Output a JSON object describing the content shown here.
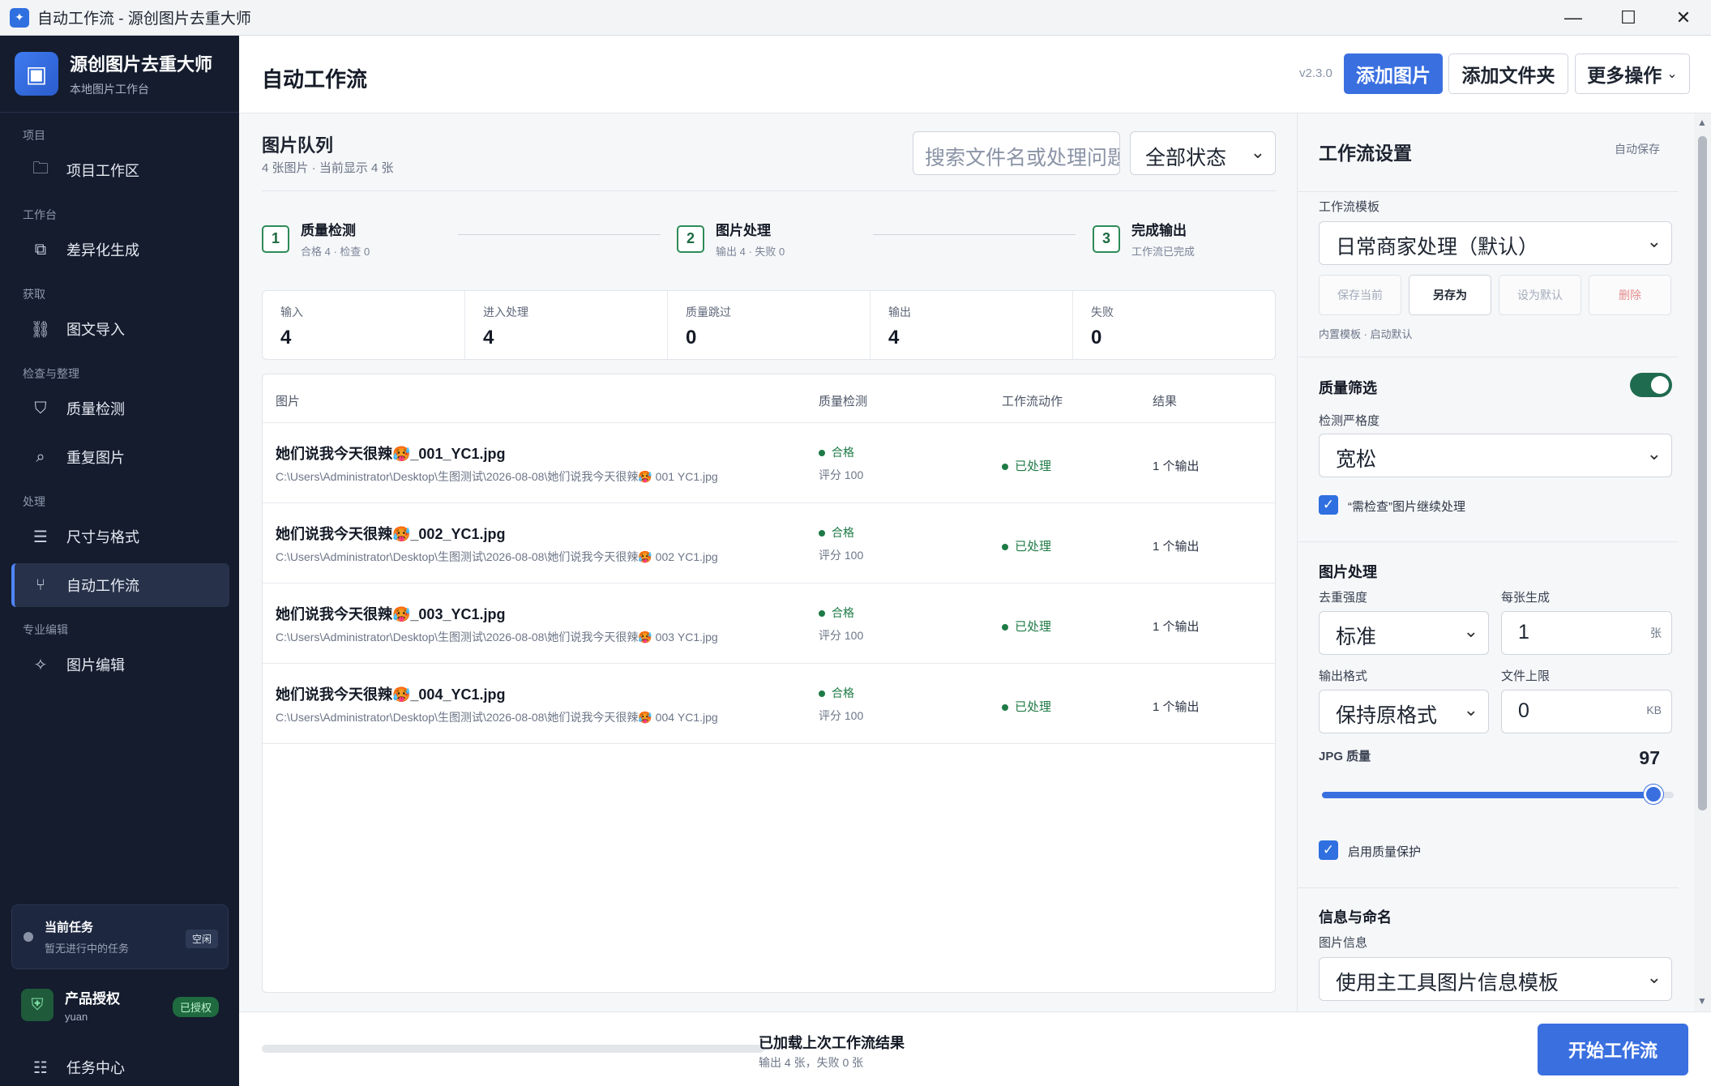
{
  "window": {
    "title": "自动工作流 - 源创图片去重大师"
  },
  "sidebar": {
    "brand_name": "源创图片去重大师",
    "brand_sub": "本地图片工作台",
    "sections": [
      {
        "title": "项目",
        "items": [
          {
            "label": "项目工作区",
            "icon": "folder-icon"
          }
        ]
      },
      {
        "title": "工作台",
        "items": [
          {
            "label": "差异化生成",
            "icon": "image-stack-icon"
          }
        ]
      },
      {
        "title": "获取",
        "items": [
          {
            "label": "图文导入",
            "icon": "link-icon"
          }
        ]
      },
      {
        "title": "检查与整理",
        "items": [
          {
            "label": "质量检测",
            "icon": "shield-check-icon"
          },
          {
            "label": "重复图片",
            "icon": "duplicate-search-icon"
          }
        ]
      },
      {
        "title": "处理",
        "items": [
          {
            "label": "尺寸与格式",
            "icon": "sliders-icon"
          },
          {
            "label": "自动工作流",
            "icon": "workflow-icon",
            "active": true
          }
        ]
      },
      {
        "title": "专业编辑",
        "items": [
          {
            "label": "图片编辑",
            "icon": "magic-wand-icon"
          }
        ]
      }
    ],
    "task": {
      "title": "当前任务",
      "sub": "暂无进行中的任务",
      "badge": "空闲"
    },
    "license": {
      "title": "产品授权",
      "user": "yuan",
      "badge": "已授权"
    },
    "task_center": "任务中心"
  },
  "header": {
    "title": "自动工作流",
    "version": "v2.3.0",
    "add_image": "添加图片",
    "add_folder": "添加文件夹",
    "more": "更多操作",
    "more_caret": "⌄"
  },
  "queue": {
    "title": "图片队列",
    "subtitle": "4 张图片 · 当前显示 4 张",
    "search_placeholder": "搜索文件名或处理问题",
    "status_filter": "全部状态",
    "steps": [
      {
        "num": "1",
        "title": "质量检测",
        "sub": "合格 4 · 检查 0"
      },
      {
        "num": "2",
        "title": "图片处理",
        "sub": "输出 4 · 失败 0"
      },
      {
        "num": "3",
        "title": "完成输出",
        "sub": "工作流已完成"
      }
    ],
    "stats": [
      {
        "label": "输入",
        "value": "4"
      },
      {
        "label": "进入处理",
        "value": "4"
      },
      {
        "label": "质量跳过",
        "value": "0"
      },
      {
        "label": "输出",
        "value": "4"
      },
      {
        "label": "失败",
        "value": "0"
      }
    ],
    "columns": {
      "image": "图片",
      "qc": "质量检测",
      "action": "工作流动作",
      "result": "结果"
    },
    "rows": [
      {
        "name": "她们说我今天很辣🥵_001_YC1.jpg",
        "path": "C:\\Users\\Administrator\\Desktop\\生图测试\\2026-08-08\\她们说我今天很辣🥵 001 YC1.jpg",
        "qc": "合格",
        "score": "评分 100",
        "action": "已处理",
        "result": "1 个输出"
      },
      {
        "name": "她们说我今天很辣🥵_002_YC1.jpg",
        "path": "C:\\Users\\Administrator\\Desktop\\生图测试\\2026-08-08\\她们说我今天很辣🥵 002 YC1.jpg",
        "qc": "合格",
        "score": "评分 100",
        "action": "已处理",
        "result": "1 个输出"
      },
      {
        "name": "她们说我今天很辣🥵_003_YC1.jpg",
        "path": "C:\\Users\\Administrator\\Desktop\\生图测试\\2026-08-08\\她们说我今天很辣🥵 003 YC1.jpg",
        "qc": "合格",
        "score": "评分 100",
        "action": "已处理",
        "result": "1 个输出"
      },
      {
        "name": "她们说我今天很辣🥵_004_YC1.jpg",
        "path": "C:\\Users\\Administrator\\Desktop\\生图测试\\2026-08-08\\她们说我今天很辣🥵 004 YC1.jpg",
        "qc": "合格",
        "score": "评分 100",
        "action": "已处理",
        "result": "1 个输出"
      }
    ]
  },
  "settings": {
    "title": "工作流设置",
    "autosave": "自动保存",
    "template_label": "工作流模板",
    "template_value": "日常商家处理（默认）",
    "template_buttons": {
      "save_current": "保存当前",
      "save_as": "另存为",
      "set_default": "设为默认",
      "delete": "删除"
    },
    "template_note": "内置模板 · 启动默认",
    "quality_filter": {
      "title": "质量筛选",
      "enabled": true,
      "strictness_label": "检测严格度",
      "strictness_value": "宽松",
      "continue_label": "“需检查”图片继续处理",
      "continue_checked": true
    },
    "processing": {
      "title": "图片处理",
      "strength_label": "去重强度",
      "strength_value": "标准",
      "per_image_label": "每张生成",
      "per_image_value": "1",
      "per_image_unit": "张",
      "format_label": "输出格式",
      "format_value": "保持原格式",
      "size_limit_label": "文件上限",
      "size_limit_value": "0",
      "size_limit_unit": "KB",
      "jpg_quality_label": "JPG 质量",
      "jpg_quality_value": "97",
      "jpg_quality_min": 0,
      "jpg_quality_max": 100,
      "quality_protect_label": "启用质量保护",
      "quality_protect_checked": true
    },
    "info": {
      "title": "信息与命名",
      "image_info_label": "图片信息",
      "image_info_value": "使用主工具图片信息模板"
    }
  },
  "bottom": {
    "progress": 0,
    "status_title": "已加载上次工作流结果",
    "status_sub": "输出 4 张，失败 0 张",
    "start_button": "开始工作流"
  },
  "colors": {
    "accent": "#3a6fe0",
    "sidebar": "#141c2e",
    "success": "#1e7a46"
  }
}
